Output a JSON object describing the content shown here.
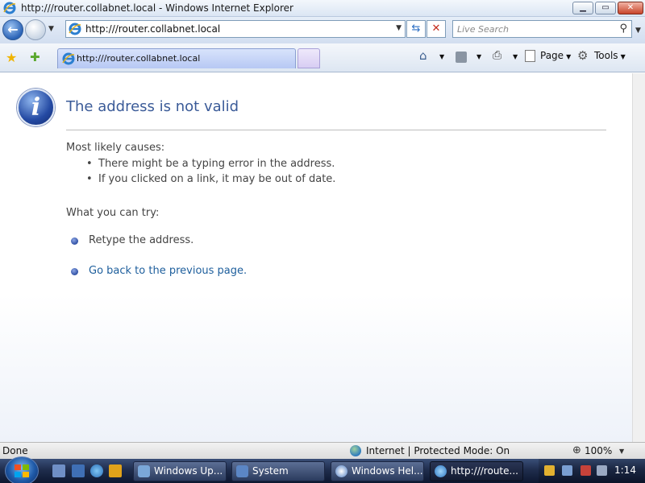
{
  "window": {
    "title": "http:///router.collabnet.local - Windows Internet Explorer",
    "min_label": "▁",
    "max_label": "▭",
    "close_label": "✕"
  },
  "address_bar": {
    "url": "http:///router.collabnet.local",
    "search_placeholder": "Live Search"
  },
  "tab": {
    "label": "http:///router.collabnet.local"
  },
  "command_bar": {
    "page_label": "Page",
    "tools_label": "Tools"
  },
  "content": {
    "title": "The address is not valid",
    "causes_heading": "Most likely causes:",
    "causes": [
      "There might be a typing error in the address.",
      "If you clicked on a link, it may be out of date."
    ],
    "try_heading": "What you can try:",
    "try_items": [
      "Retype the address.",
      "Go back to the previous page."
    ]
  },
  "status_bar": {
    "status": "Done",
    "zone": "Internet | Protected Mode: On",
    "zoom": "100%"
  },
  "taskbar": {
    "tasks": [
      "Windows Up...",
      "System",
      "Windows Hel...",
      "http:///route..."
    ],
    "clock": "1:14"
  },
  "icons": {
    "ie": "ie-icon",
    "info": "info-icon",
    "globe": "globe-icon",
    "favorites": "favorites-star-icon",
    "add_favorite": "add-favorite-icon",
    "home": "home-icon",
    "feeds": "rss-icon",
    "print": "print-icon",
    "page": "page-icon",
    "tools": "gear-icon"
  },
  "colors": {
    "title_blue": "#3b5b98",
    "link_blue": "#1d5e9c",
    "tab_blue": "#b7c8f4"
  }
}
